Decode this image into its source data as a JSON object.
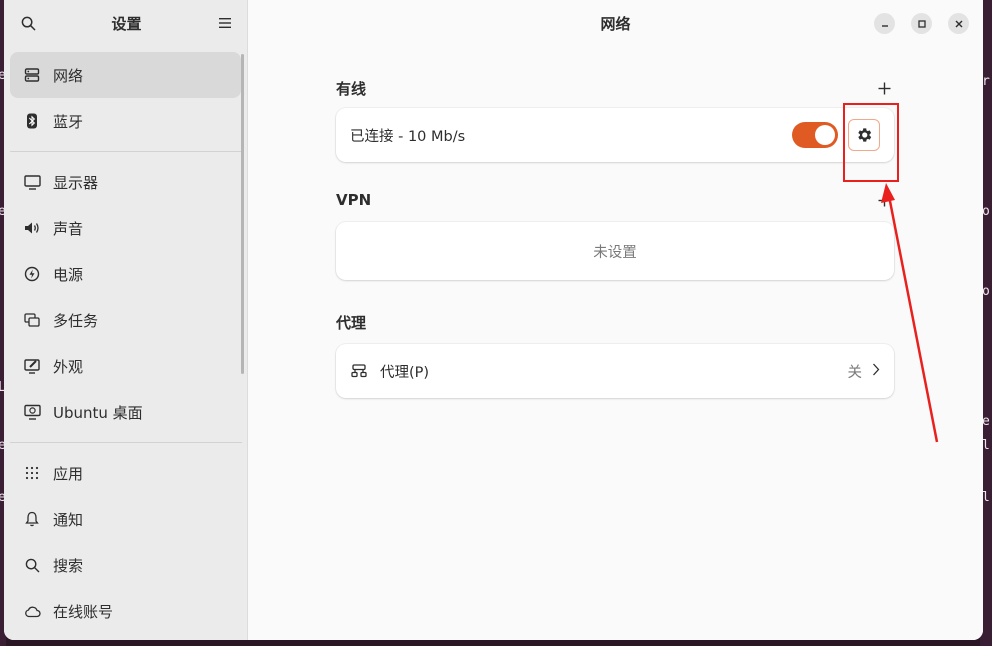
{
  "sidebar": {
    "title": "设置",
    "items": [
      {
        "label": "网络",
        "icon": "network-icon",
        "active": true
      },
      {
        "label": "蓝牙",
        "icon": "bluetooth-icon"
      },
      {
        "label": "显示器",
        "icon": "display-icon"
      },
      {
        "label": "声音",
        "icon": "sound-icon"
      },
      {
        "label": "电源",
        "icon": "power-icon"
      },
      {
        "label": "多任务",
        "icon": "multitask-icon"
      },
      {
        "label": "外观",
        "icon": "appearance-icon"
      },
      {
        "label": "Ubuntu 桌面",
        "icon": "ubuntu-desktop-icon"
      },
      {
        "label": "应用",
        "icon": "apps-icon"
      },
      {
        "label": "通知",
        "icon": "bell-icon"
      },
      {
        "label": "搜索",
        "icon": "search-icon"
      },
      {
        "label": "在线账号",
        "icon": "cloud-icon"
      }
    ]
  },
  "header": {
    "title": "网络"
  },
  "wired": {
    "title": "有线",
    "status": "已连接 - 10 Mb/s",
    "enabled": true
  },
  "vpn": {
    "title": "VPN",
    "empty": "未设置"
  },
  "proxy": {
    "title": "代理",
    "label": "代理(P)",
    "status": "关"
  },
  "colors": {
    "accent": "#e05a24",
    "annotation": "#e8211f"
  }
}
